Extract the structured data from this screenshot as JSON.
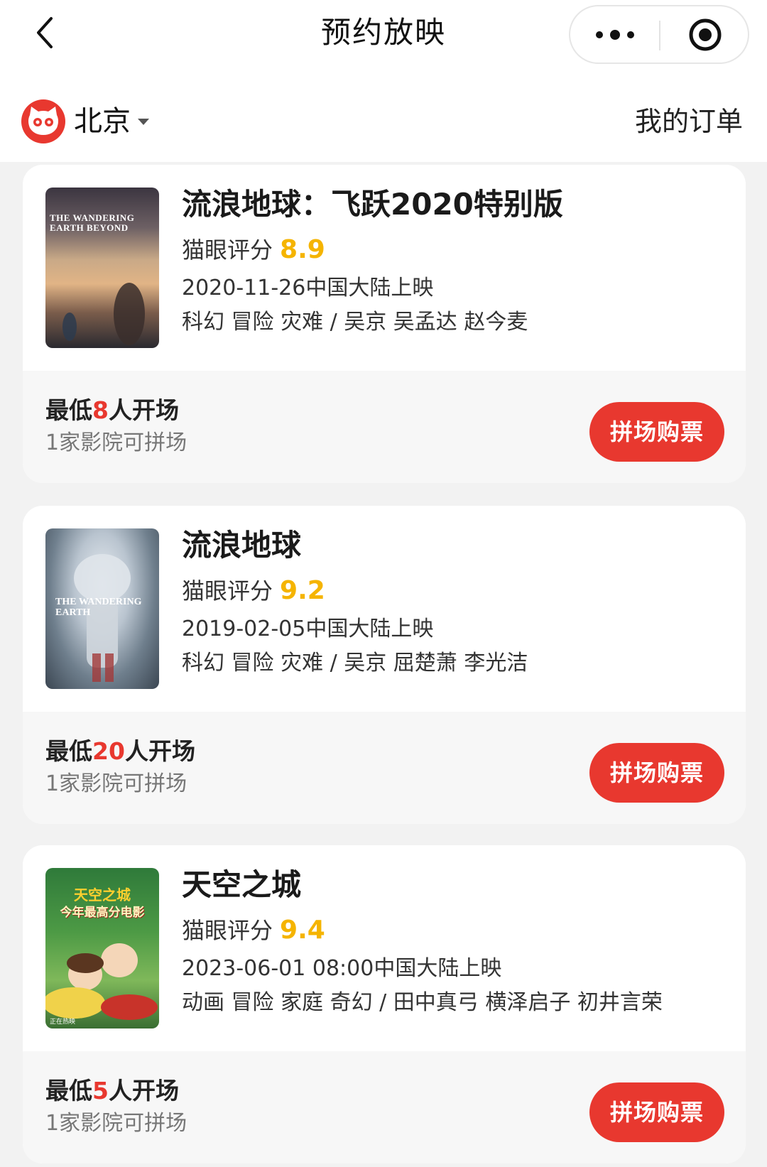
{
  "nav": {
    "title": "预约放映",
    "back_icon": "chevron-left-icon",
    "more_icon": "more-dots-icon",
    "target_icon": "target-icon"
  },
  "city_bar": {
    "city": "北京",
    "orders_label": "我的订单",
    "logo_icon": "maoyan-cat-logo-icon"
  },
  "labels": {
    "score_prefix": "猫眼评分",
    "min_prefix": "最低",
    "min_suffix": "人开场",
    "buy_label": "拼场购票"
  },
  "movies": [
    {
      "title": "流浪地球：飞跃2020特别版",
      "score": "8.9",
      "release": "2020-11-26中国大陆上映",
      "genre_cast": "科幻 冒险 灾难 / 吴京 吴孟达 赵今麦",
      "min_people": "8",
      "cinemas": "1家影院可拼场",
      "poster_text": "THE WANDERING EARTH BEYOND"
    },
    {
      "title": "流浪地球",
      "score": "9.2",
      "release": "2019-02-05中国大陆上映",
      "genre_cast": "科幻 冒险 灾难 / 吴京 屈楚萧 李光洁",
      "min_people": "20",
      "cinemas": "1家影院可拼场",
      "poster_text": "THE WANDERING EARTH"
    },
    {
      "title": "天空之城",
      "score": "9.4",
      "release": "2023-06-01 08:00中国大陆上映",
      "genre_cast": "动画 冒险 家庭 奇幻 / 田中真弓 横泽启子 初井言荣",
      "min_people": "5",
      "cinemas": "1家影院可拼场",
      "poster_title": "天空之城",
      "poster_tag": "今年最高分电影",
      "poster_note": "正在热映"
    }
  ],
  "colors": {
    "accent": "#e8382f",
    "score": "#f5b400",
    "background": "#f2f2f2"
  }
}
